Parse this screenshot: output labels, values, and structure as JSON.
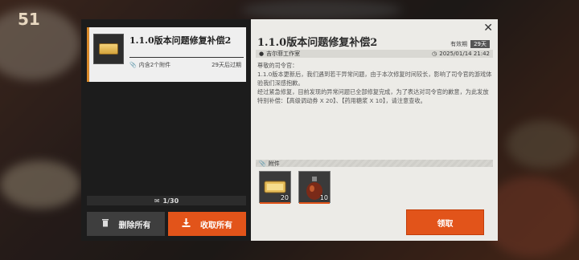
{
  "background": {
    "corner_number": "51"
  },
  "mail_list": {
    "items": [
      {
        "title": "1.1.0版本问题修复补偿2",
        "attachments_label": "内含2个附件",
        "expire_label": "29天后过期"
      }
    ],
    "count_label": "1/30",
    "delete_all_label": "删除所有",
    "collect_all_label": "收取所有"
  },
  "detail": {
    "title": "1.1.0版本问题修复补偿2",
    "validity_label": "有效期",
    "validity_value": "29天",
    "sender": "吉尔菲工作室",
    "date": "2025/01/14 21:42",
    "body": [
      "尊敬的司令官：",
      "1.1.0版本更新后，我们遇到若干异常问题，由于本次修复时间较长，影响了司令官的游戏体验我们深感抱歉。",
      "经过紧急修复，目前发现的异常问题已全部修复完成，为了表达对司令官的歉意，为此发放特别补偿：【高级调动券 X 20】、【药用糖浆 X 10】，请注意查收。"
    ],
    "attachments_label": "附件",
    "attachments": [
      {
        "icon": "ticket-icon",
        "quantity": "20"
      },
      {
        "icon": "syrup-bottle-icon",
        "quantity": "10"
      }
    ],
    "claim_label": "领取",
    "close_icon": "close-icon"
  },
  "colors": {
    "accent": "#e2541a",
    "panel_dark": "#1c1c1c",
    "panel_light": "#ecebe7"
  }
}
